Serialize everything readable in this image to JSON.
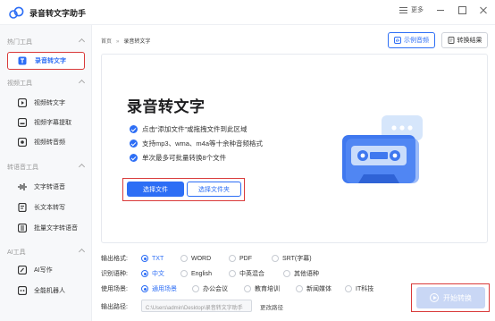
{
  "app": {
    "title": "录音转文字助手",
    "more_label": "更多"
  },
  "sidebar": {
    "sections": [
      {
        "label": "热门工具",
        "items": [
          {
            "label": "录音转文字",
            "icon": "text-icon",
            "active": true
          }
        ]
      },
      {
        "label": "视频工具",
        "items": [
          {
            "label": "视频转文字",
            "icon": "video-icon"
          },
          {
            "label": "视频字幕提取",
            "icon": "subtitle-icon"
          },
          {
            "label": "视频转音频",
            "icon": "video-audio-icon"
          }
        ]
      },
      {
        "label": "转语音工具",
        "items": [
          {
            "label": "文字转语音",
            "icon": "waveform-icon"
          },
          {
            "label": "长文本转写",
            "icon": "long-text-icon"
          },
          {
            "label": "批量文字转语音",
            "icon": "batch-icon"
          }
        ]
      },
      {
        "label": "AI工具",
        "items": [
          {
            "label": "AI写作",
            "icon": "ai-write-icon"
          },
          {
            "label": "全能机器人",
            "icon": "robot-icon"
          }
        ]
      }
    ]
  },
  "breadcrumb": {
    "home": "首页",
    "separator": "»",
    "current": "录音转文字"
  },
  "toolbar": {
    "examples_label": "示例音频",
    "results_label": "转换结果"
  },
  "dropzone": {
    "title": "录音转文字",
    "features": [
      "点击“添加文件”或拖拽文件到此区域",
      "支持mp3、wma、m4a等十余种音频格式",
      "单次最多可批量转换8个文件"
    ],
    "select_file_label": "选择文件",
    "select_folder_label": "选择文件夹"
  },
  "options": {
    "format": {
      "label": "输出格式:",
      "choices": [
        "TXT",
        "WORD",
        "PDF",
        "SRT(字幕)"
      ],
      "selected": "TXT"
    },
    "language": {
      "label": "识别语种:",
      "choices": [
        "中文",
        "English",
        "中英混合",
        "其他语种"
      ],
      "selected": "中文"
    },
    "scene": {
      "label": "使用场景:",
      "choices": [
        "通用场景",
        "办公会议",
        "教育培训",
        "新闻媒体",
        "IT科技"
      ],
      "selected": "通用场景"
    },
    "path": {
      "label": "输出路径:",
      "value": "C:\\Users\\admin\\Desktop\\录音转文字助手",
      "change_label": "更改路径"
    }
  },
  "start_label": "开始转换",
  "colors": {
    "accent": "#2d6ef5",
    "highlight": "#d93a3a"
  }
}
